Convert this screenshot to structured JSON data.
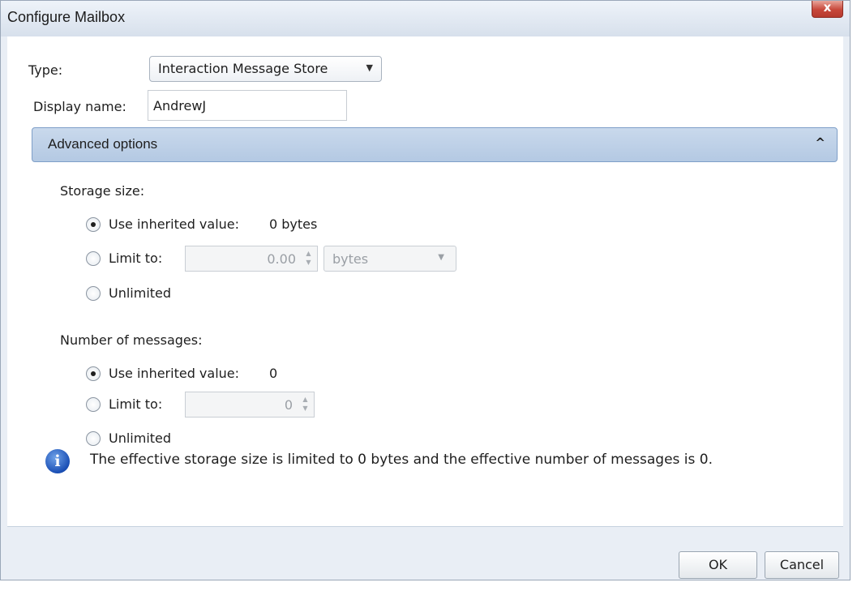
{
  "window": {
    "title": "Configure Mailbox",
    "close_glyph": "x"
  },
  "form": {
    "type_label": "Type:",
    "type_value": "Interaction Message Store",
    "display_name_label": "Display name:",
    "display_name_value": "AndrewJ"
  },
  "advanced": {
    "label": "Advanced options",
    "expanded": true,
    "storage": {
      "heading": "Storage size:",
      "inherited_label": "Use inherited value:",
      "inherited_value": "0 bytes",
      "limit_label": "Limit to:",
      "limit_value": "0.00",
      "unit_value": "bytes",
      "unlimited_label": "Unlimited",
      "selected": "inherited"
    },
    "messages": {
      "heading": "Number of messages:",
      "inherited_label": "Use inherited value:",
      "inherited_value": "0",
      "limit_label": "Limit to:",
      "limit_value": "0",
      "unlimited_label": "Unlimited",
      "selected": "inherited"
    }
  },
  "info": {
    "icon": "info-icon",
    "text": "The effective storage size is limited to 0 bytes and the effective number of messages is 0."
  },
  "buttons": {
    "ok": "OK",
    "cancel": "Cancel"
  }
}
